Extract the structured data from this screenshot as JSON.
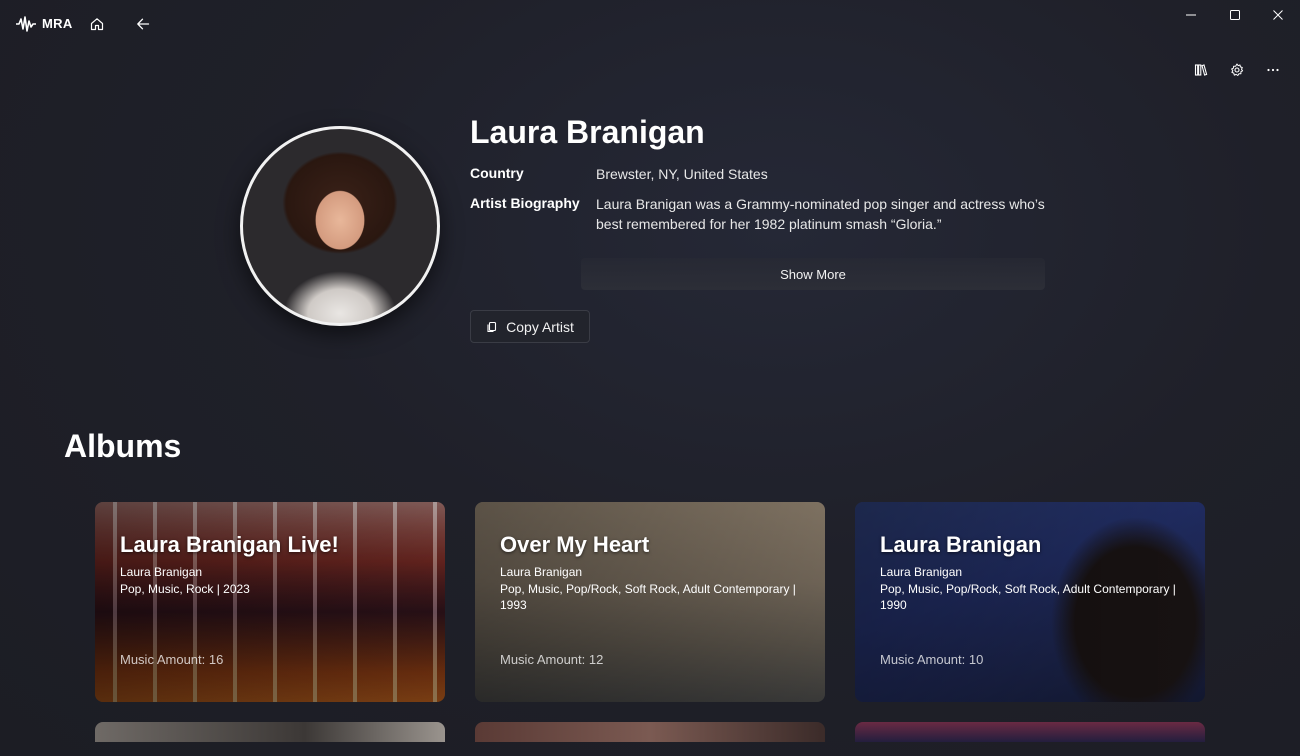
{
  "app": {
    "name": "MRA"
  },
  "titlebar": {
    "icons": [
      "mra-logo-icon",
      "home-icon",
      "back-arrow-icon",
      "minimize-icon",
      "maximize-icon",
      "close-icon"
    ]
  },
  "toolbar": {
    "icons": [
      "library-icon",
      "gear-icon",
      "more-dots-icon"
    ]
  },
  "artist": {
    "name": "Laura Branigan",
    "country_label": "Country",
    "country_value": "Brewster, NY, United States",
    "bio_label": "Artist Biography",
    "bio_value": "Laura Branigan was a Grammy-nominated pop singer and actress who’s best remembered for her 1982 platinum smash “Gloria.”",
    "show_more_label": "Show More",
    "copy_artist_label": "Copy Artist"
  },
  "albums_section": {
    "title": "Albums",
    "items": [
      {
        "title": "Laura Branigan Live!",
        "artist": "Laura Branigan",
        "meta": "Pop, Music, Rock | 2023",
        "count": "Music Amount: 16"
      },
      {
        "title": "Over My Heart",
        "artist": "Laura Branigan",
        "meta": "Pop, Music, Pop/Rock, Soft Rock, Adult Contemporary | 1993",
        "count": "Music Amount: 12"
      },
      {
        "title": "Laura Branigan",
        "artist": "Laura Branigan",
        "meta": "Pop, Music, Pop/Rock, Soft Rock, Adult Contemporary | 1990",
        "count": "Music Amount: 10"
      }
    ]
  },
  "colors": {
    "background": "#1e1f25",
    "text": "#ffffff",
    "button": "#22242c"
  }
}
